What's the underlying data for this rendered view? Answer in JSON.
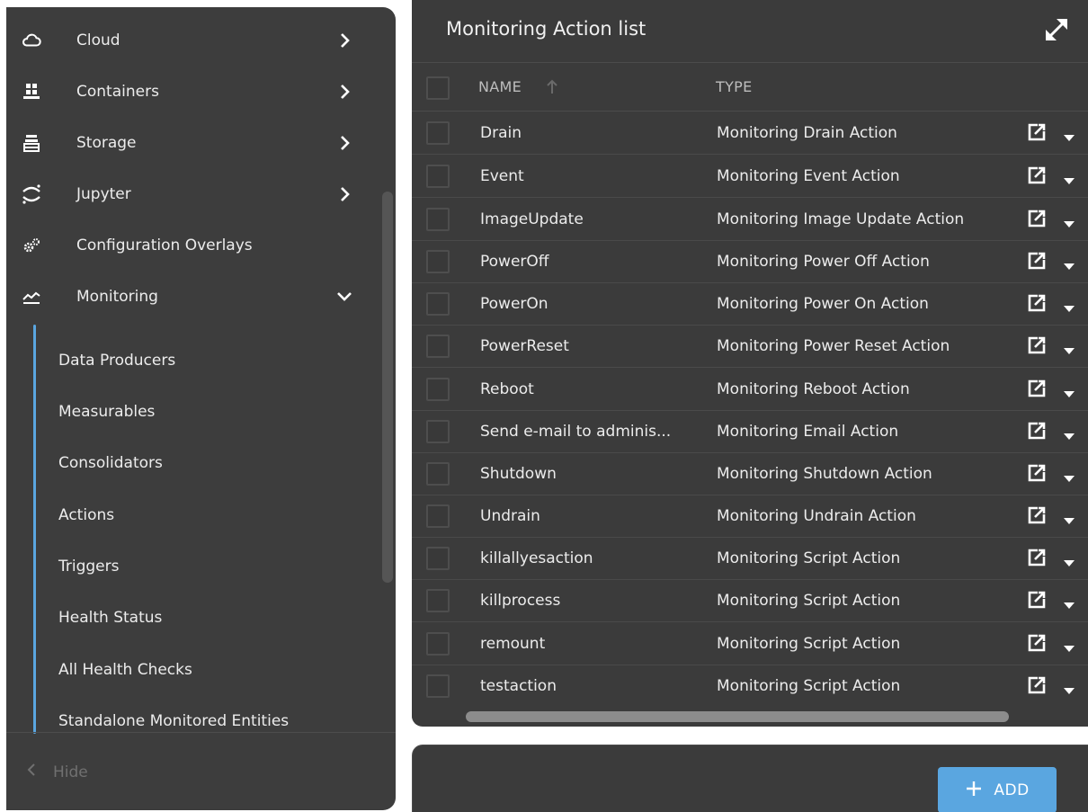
{
  "sidebar": {
    "items": [
      {
        "label": "Cloud",
        "icon": "cloud-icon",
        "expanded": false
      },
      {
        "label": "Containers",
        "icon": "containers-icon",
        "expanded": false
      },
      {
        "label": "Storage",
        "icon": "storage-icon",
        "expanded": false
      },
      {
        "label": "Jupyter",
        "icon": "jupyter-icon",
        "expanded": false
      },
      {
        "label": "Configuration Overlays",
        "icon": "gears-icon"
      },
      {
        "label": "Monitoring",
        "icon": "monitoring-chart-icon",
        "expanded": true
      }
    ],
    "subitems": [
      {
        "label": "Data Producers"
      },
      {
        "label": "Measurables"
      },
      {
        "label": "Consolidators"
      },
      {
        "label": "Actions"
      },
      {
        "label": "Triggers"
      },
      {
        "label": "Health Status"
      },
      {
        "label": "All Health Checks"
      },
      {
        "label": "Standalone Monitored Entities"
      }
    ],
    "hide_label": "Hide"
  },
  "panel": {
    "title": "Monitoring Action list",
    "columns": {
      "name": "NAME",
      "type": "TYPE"
    },
    "rows": [
      {
        "name": "Drain",
        "type": "Monitoring Drain Action"
      },
      {
        "name": "Event",
        "type": "Monitoring Event Action"
      },
      {
        "name": "ImageUpdate",
        "type": "Monitoring Image Update Action"
      },
      {
        "name": "PowerOff",
        "type": "Monitoring Power Off Action"
      },
      {
        "name": "PowerOn",
        "type": "Monitoring Power On Action"
      },
      {
        "name": "PowerReset",
        "type": "Monitoring Power Reset Action"
      },
      {
        "name": "Reboot",
        "type": "Monitoring Reboot Action"
      },
      {
        "name": "Send e-mail to adminis...",
        "type": "Monitoring Email Action"
      },
      {
        "name": "Shutdown",
        "type": "Monitoring Shutdown Action"
      },
      {
        "name": "Undrain",
        "type": "Monitoring Undrain Action"
      },
      {
        "name": "killallyesaction",
        "type": "Monitoring Script Action"
      },
      {
        "name": "killprocess",
        "type": "Monitoring Script Action"
      },
      {
        "name": "remount",
        "type": "Monitoring Script Action"
      },
      {
        "name": "testaction",
        "type": "Monitoring Script Action"
      }
    ]
  },
  "footer": {
    "add_label": "ADD"
  },
  "colors": {
    "sidebar_bg": "#3d3d3d",
    "panel_bg": "#3b3b3b",
    "accent": "#5aa6e0"
  }
}
